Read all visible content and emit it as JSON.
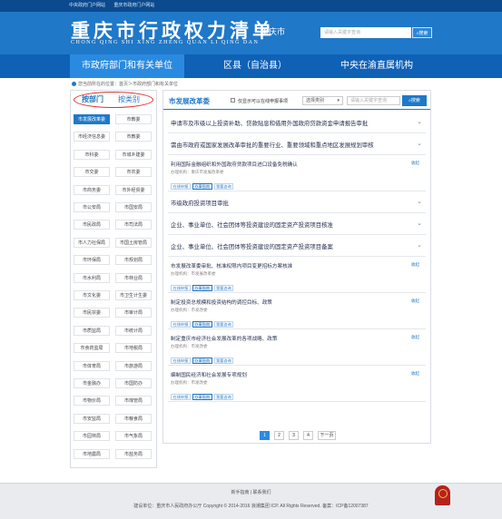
{
  "topbar": {
    "link1": "中央政府门户网站",
    "link2": "重庆市政府门户网站"
  },
  "header": {
    "logo_cn": "重庆市行政权力清单",
    "logo_py": "CHONG QING SHI  XING ZHENG QUAN LI QING DAN",
    "city": "重庆市",
    "search_placeholder": "请输入关键字查询",
    "search_button": "搜索"
  },
  "nav": {
    "tabs": [
      "市政府部门和有关单位",
      "区县（自治县）",
      "中央在渝直属机构"
    ]
  },
  "breadcrumb": {
    "prefix": "您当前所在的位置：",
    "home": "首页",
    "sep1": "＞",
    "current": "市政府部门和有关单位"
  },
  "left_panel": {
    "tab_by_dept": "按部门",
    "tab_by_type": "按类别",
    "departments": [
      "市发展改革委",
      "市教委",
      "市经济信息委",
      "市教委",
      "市科委",
      "市城乡建委",
      "市交委",
      "市农委",
      "市商务委",
      "市外经贸委",
      "市公安局",
      "市国安局",
      "市民政局",
      "市司法局",
      "市人力社保局",
      "市国土房管局",
      "市环保局",
      "市规划局",
      "市水利局",
      "市林业局",
      "市文化委",
      "市卫生计生委",
      "市民宗委",
      "市审计局",
      "市质监局",
      "市统计局",
      "市食药监局",
      "市地税局",
      "市体育局",
      "市旅游局",
      "市金融办",
      "市国防办",
      "市物价局",
      "市煤管局",
      "市安监局",
      "市粮食局",
      "市园林局",
      "市气象局",
      "市地震局",
      "市盐务局"
    ]
  },
  "right_panel": {
    "title": "市发展改革委",
    "checkbox_label": "仅显示可以在线申报事项",
    "select_value": "选择类别",
    "search_placeholder": "请输入关键字查询",
    "search_button": "搜索",
    "items": [
      {
        "title": "申请市及市级以上投资补助、贷款贴息和借用外国政府贷款资金申请报告审批"
      },
      {
        "title": "需由市政府或国家发展改革审批的重要行业、重要领域和重点地区发展规划审核"
      },
      {
        "title": "利用国际金融组织和外国政府贷款项目进口设备免税确认",
        "org": "办理机构：重庆市发展改革委",
        "buttons": [
          "在线申报",
          "办事指南",
          "我要咨询"
        ],
        "fold": "收起"
      },
      {
        "title": "市级政府投资项目审批"
      },
      {
        "title": "企业、事业单位、社会团体等投资建设的固定资产投资项目核准"
      },
      {
        "title": "企业、事业单位、社会团体等投资建设的固定资产投资项目备案"
      },
      {
        "title": "市发展改革委审批、核准权限内项目变更招标方案核准",
        "org": "办理机构：市发展改革委",
        "buttons": [
          "在线申报",
          "办事指南",
          "我要咨询"
        ],
        "fold": "收起"
      },
      {
        "title": "制定投资总规模和投资结构的调控目标、政策",
        "org": "办理机构：市发改委",
        "buttons": [
          "在线申报",
          "办事指南",
          "我要咨询"
        ],
        "fold": "收起"
      },
      {
        "title": "制定重庆市经济社会发展改革的各项战略、政策",
        "org": "办理机构：市发改委",
        "buttons": [
          "在线申报",
          "办事指南",
          "我要咨询"
        ],
        "fold": "收起"
      },
      {
        "title": "编制国民经济和社会发展专项规划",
        "org": "办理机构：市发改委",
        "buttons": [
          "在线申报",
          "办事指南",
          "我要咨询"
        ],
        "fold": "收起"
      }
    ],
    "pager": {
      "pages": [
        "1",
        "2",
        "3",
        "4"
      ],
      "next": "下一页"
    }
  },
  "footer": {
    "links": "新手指南 | 联系我们",
    "copyright": "建设单位：重庆市人民政府办公厅    Copyright © 2014-2016 浪潮集团 ICP. All Rights Reserved.    备案：ICP备12007387"
  },
  "colors": {
    "brand": "#1f78c8",
    "nav": "#0f61b6",
    "highlight_oval": "#e0312a"
  }
}
